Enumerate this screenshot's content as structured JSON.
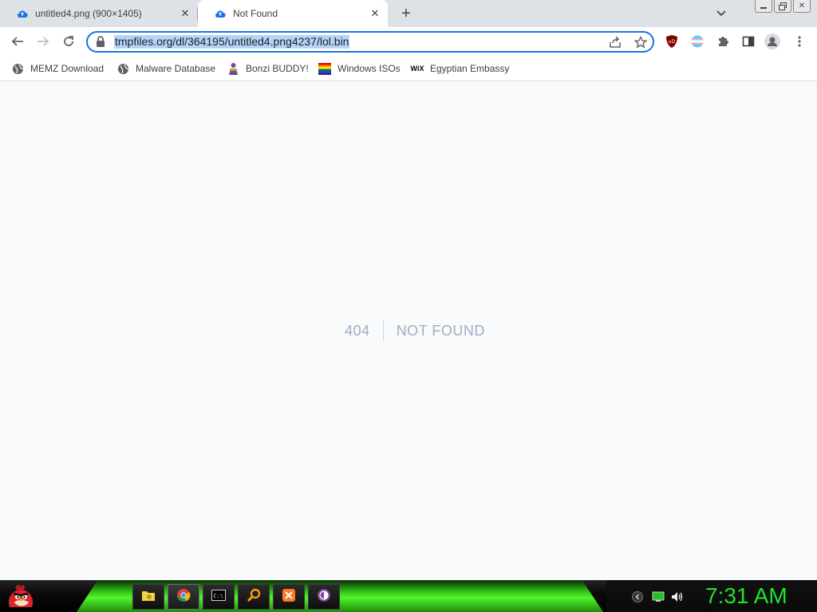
{
  "browser": {
    "tabs": [
      {
        "title": "untitled4.png (900×1405)",
        "active": false,
        "icon": "cloud-upload-icon"
      },
      {
        "title": "Not Found",
        "active": true,
        "icon": "cloud-upload-icon"
      }
    ],
    "new_tab_symbol": "+",
    "url": "tmpfiles.org/dl/364195/untitled4.png4237/lol.bin",
    "bookmarks": [
      {
        "label": "MEMZ Download",
        "icon": "globe-icon"
      },
      {
        "label": "Malware Database",
        "icon": "globe-icon"
      },
      {
        "label": "Bonzi BUDDY!",
        "icon": "bonzi-icon"
      },
      {
        "label": "Windows ISOs",
        "icon": "rainbow-flag-icon"
      },
      {
        "label": "Egyptian Embassy",
        "icon": "wix-icon"
      }
    ],
    "wix_text": "WiX"
  },
  "page": {
    "code": "404",
    "message": "Not Found"
  },
  "taskbar": {
    "clock": "7:31 AM",
    "items": [
      "file-manager-icon",
      "chrome-icon",
      "command-prompt-icon",
      "search-icon",
      "xampp-icon",
      "tor-browser-icon"
    ]
  },
  "colors": {
    "accent": "#1a73e8",
    "clock": "#22e12a",
    "page_bg": "#f8fafc",
    "notfound_text": "#a0aec0"
  }
}
